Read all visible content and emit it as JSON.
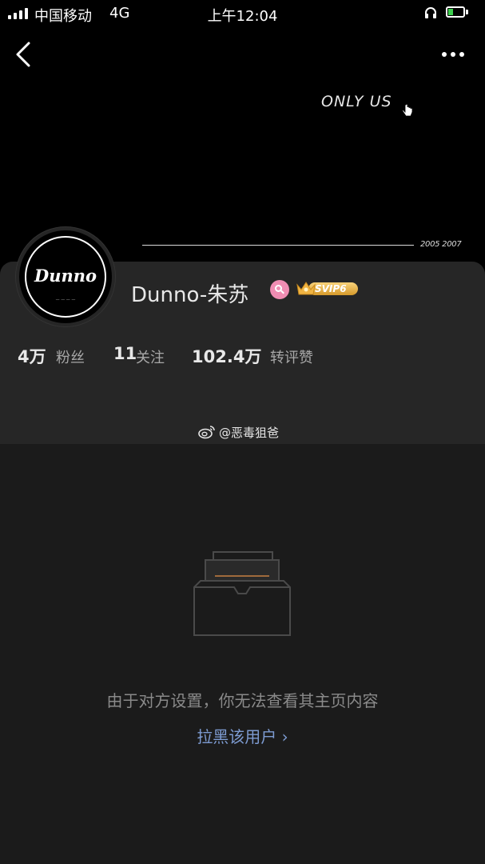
{
  "status_bar": {
    "carrier": "中国移动",
    "network": "4G",
    "time": "上午12:04"
  },
  "banner": {
    "title": "ONLY US",
    "years": "2005 2007"
  },
  "avatar": {
    "text": "Dunno"
  },
  "profile": {
    "name": "Dunno-朱苏",
    "svip_label": "SVIP6"
  },
  "stats": {
    "followers_count": "4万",
    "followers_label": "粉丝",
    "following_count": "11",
    "following_label": "关注",
    "reposts_count": "102.4万",
    "reposts_label": "转评赞"
  },
  "watermark": {
    "text": "@恶毒狙爸"
  },
  "empty_state": {
    "message": "由于对方设置，你无法查看其主页内容",
    "block_link": "拉黑该用户 ›"
  },
  "colors": {
    "banner_bg": "#000000",
    "card_bg": "#262626",
    "page_bg": "#1b1b1b",
    "link": "#7d9bd1",
    "verified": "#f08db3",
    "svip": "#e3ac45"
  }
}
